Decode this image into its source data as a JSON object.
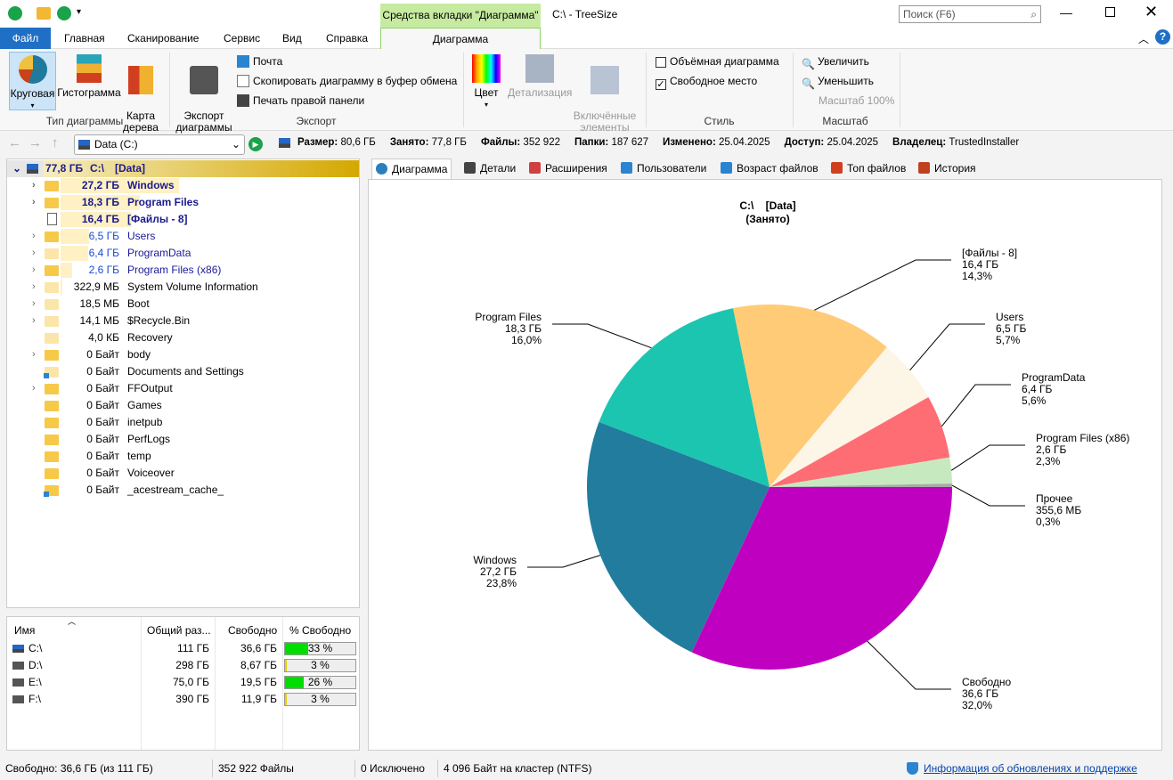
{
  "window": {
    "title": "C:\\ - TreeSize",
    "context_tab_group": "Средства вкладки \"Диаграмма\"",
    "search_placeholder": "Поиск (F6)"
  },
  "ribbon": {
    "tabs": [
      "Файл",
      "Главная",
      "Сканирование",
      "Сервис",
      "Вид",
      "Справка",
      "Диаграмма"
    ],
    "active_tab": "Диаграмма",
    "chart_type": {
      "label": "Тип диаграммы",
      "pie": "Круговая",
      "histogram": "Гистограмма",
      "treemap": "Карта\nдерева"
    },
    "export": {
      "label": "Экспорт",
      "export_chart": "Экспорт\nдиаграммы",
      "mail": "Почта",
      "copy": "Скопировать диаграмму в буфер обмена",
      "print": "Печать правой панели"
    },
    "color": {
      "color": "Цвет",
      "detail": "Детализация",
      "included": "Включённые\nэлементы"
    },
    "style": {
      "label": "Стиль",
      "three_d": "Объёмная диаграмма",
      "three_d_checked": false,
      "free_space": "Свободное место",
      "free_space_checked": true
    },
    "zoom": {
      "label": "Масштаб",
      "zoom_in": "Увеличить",
      "zoom_out": "Уменьшить",
      "zoom_level": "Масштаб 100%"
    }
  },
  "nav": {
    "path": "Data (C:)",
    "info": [
      {
        "k": "Размер:",
        "v": "80,6 ГБ"
      },
      {
        "k": "Занято:",
        "v": "77,8 ГБ"
      },
      {
        "k": "Файлы:",
        "v": "352 922"
      },
      {
        "k": "Папки:",
        "v": "187 627"
      },
      {
        "k": "Изменено:",
        "v": "25.04.2025"
      },
      {
        "k": "Доступ:",
        "v": "25.04.2025"
      },
      {
        "k": "Владелец:",
        "v": "TrustedInstaller"
      }
    ]
  },
  "tree": {
    "root": {
      "size": "77,8 ГБ",
      "name": "C:\\",
      "label": "[Data]"
    },
    "items": [
      {
        "size": "27,2 ГБ",
        "name": "Windows",
        "bold": true,
        "exp": true,
        "pct": 0.35
      },
      {
        "size": "18,3 ГБ",
        "name": "Program Files",
        "bold": true,
        "exp": true,
        "pct": 0.235
      },
      {
        "size": "16,4 ГБ",
        "name": "[Файлы - 8]",
        "bold": true,
        "exp": false,
        "file": true,
        "pct": 0.21
      },
      {
        "size": "6,5 ГБ",
        "name": "Users",
        "exp": true,
        "blue": true,
        "pct": 0.084
      },
      {
        "size": "6,4 ГБ",
        "name": "ProgramData",
        "exp": true,
        "blue": true,
        "pale": true,
        "pct": 0.082
      },
      {
        "size": "2,6 ГБ",
        "name": "Program Files (x86)",
        "exp": true,
        "blue": true,
        "pct": 0.033
      },
      {
        "size": "322,9 МБ",
        "name": "System Volume Information",
        "exp": true,
        "pale": true,
        "pct": 0.004
      },
      {
        "size": "18,5 МБ",
        "name": "Boot",
        "exp": true,
        "pale": true
      },
      {
        "size": "14,1 МБ",
        "name": "$Recycle.Bin",
        "exp": true,
        "pale": true
      },
      {
        "size": "4,0 КБ",
        "name": "Recovery",
        "exp": false,
        "pale": true
      },
      {
        "size": "0 Байт",
        "name": "body",
        "exp": true
      },
      {
        "size": "0 Байт",
        "name": "Documents and Settings",
        "exp": false,
        "pale": true,
        "link": true
      },
      {
        "size": "0 Байт",
        "name": "FFOutput",
        "exp": true
      },
      {
        "size": "0 Байт",
        "name": "Games",
        "exp": false
      },
      {
        "size": "0 Байт",
        "name": "inetpub",
        "exp": false
      },
      {
        "size": "0 Байт",
        "name": "PerfLogs",
        "exp": false
      },
      {
        "size": "0 Байт",
        "name": "temp",
        "exp": false
      },
      {
        "size": "0 Байт",
        "name": "Voiceover",
        "exp": false
      },
      {
        "size": "0 Байт",
        "name": "_acestream_cache_",
        "exp": false,
        "link": true
      }
    ]
  },
  "drives": {
    "headers": [
      "Имя",
      "Общий раз...",
      "Свободно",
      "% Свободно"
    ],
    "rows": [
      {
        "name": "C:\\",
        "total": "111 ГБ",
        "free": "36,6 ГБ",
        "pct": "33 %",
        "fill": 0.33
      },
      {
        "name": "D:\\",
        "total": "298 ГБ",
        "free": "8,67 ГБ",
        "pct": "3 %",
        "fill": 0.03
      },
      {
        "name": "E:\\",
        "total": "75,0 ГБ",
        "free": "19,5 ГБ",
        "pct": "26 %",
        "fill": 0.26
      },
      {
        "name": "F:\\",
        "total": "390 ГБ",
        "free": "11,9 ГБ",
        "pct": "3 %",
        "fill": 0.03
      }
    ]
  },
  "content_tabs": [
    "Диаграмма",
    "Детали",
    "Расширения",
    "Пользователи",
    "Возраст файлов",
    "Топ файлов",
    "История"
  ],
  "chart_data": {
    "type": "pie",
    "title": "C:\\    [Data]",
    "subtitle": "(Занято)",
    "slices": [
      {
        "name": "Свободно",
        "size": "36,6 ГБ",
        "pct_label": "32,0%",
        "value": 32.0,
        "color": "#c000c0"
      },
      {
        "name": "Windows",
        "size": "27,2 ГБ",
        "pct_label": "23,8%",
        "value": 23.8,
        "color": "#227c9d"
      },
      {
        "name": "Program Files",
        "size": "18,3 ГБ",
        "pct_label": "16,0%",
        "value": 16.0,
        "color": "#1cc5b0"
      },
      {
        "name": "[Файлы - 8]",
        "size": "16,4 ГБ",
        "pct_label": "14,3%",
        "value": 14.3,
        "color": "#ffcb77"
      },
      {
        "name": "Users",
        "size": "6,5 ГБ",
        "pct_label": "5,7%",
        "value": 5.7,
        "color": "#fdf6e7"
      },
      {
        "name": "ProgramData",
        "size": "6,4 ГБ",
        "pct_label": "5,6%",
        "value": 5.6,
        "color": "#fe6d73"
      },
      {
        "name": "Program Files (x86)",
        "size": "2,6 ГБ",
        "pct_label": "2,3%",
        "value": 2.3,
        "color": "#c7e9c0"
      },
      {
        "name": "Прочее",
        "size": "355,6 МБ",
        "pct_label": "0,3%",
        "value": 0.3,
        "color": "#aaaaaa"
      }
    ]
  },
  "status": {
    "free": "Свободно: 36,6 ГБ  (из 111 ГБ)",
    "files": "352 922 Файлы",
    "excluded": "0 Исключено",
    "cluster": "4 096 Байт на кластер (NTFS)",
    "update_link": "Информация об обновлениях и поддержке"
  }
}
